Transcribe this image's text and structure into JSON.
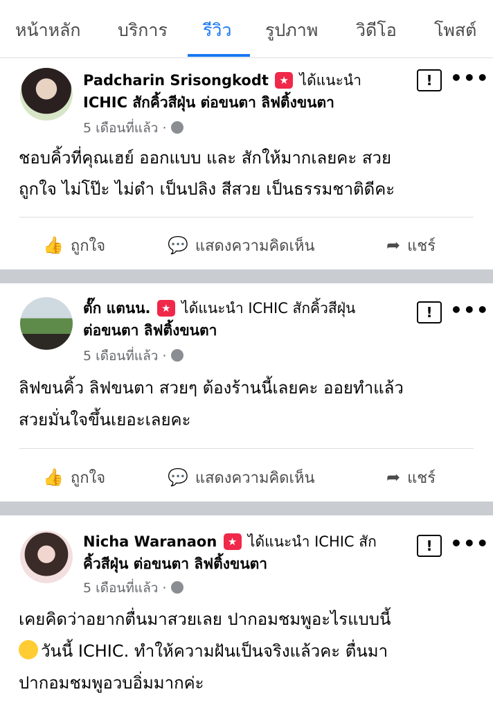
{
  "tabs": [
    "หน้าหลัก",
    "บริการ",
    "รีวิว",
    "รูปภาพ",
    "วิดีโอ",
    "โพสต์"
  ],
  "actions": {
    "like": "ถูกใจ",
    "comment": "แสดงความคิดเห็น",
    "share": "แชร์"
  },
  "badge_glyph": "★",
  "report_glyph": "!",
  "more_glyph": "•••",
  "icons": {
    "like": "thumbs-up-icon",
    "comment": "comment-bubble-icon",
    "share": "share-arrow-icon",
    "privacy": "globe-icon"
  },
  "posts": [
    {
      "line1": {
        "name": "Padcharin Srisongkodt",
        "rec": "ได้แนะนำ"
      },
      "line2": "ICHIC สักคิ้วสีฝุ่น ต่อขนตา ลิฟติ้งขนตา",
      "time": "5 เดือนที่แล้ว ·",
      "text": [
        "ชอบคิ้วที่คุณเฮย์  ออกแบบ และ สักให้มากเลยคะ สวย",
        "ถูกใจ ไม่โป๊ะ ไม่ดำ เป็นปลิง สีสวย เป็นธรรมชาติดีคะ"
      ]
    },
    {
      "line1": {
        "name": "ตั๊ก แตนน.",
        "rec": "ได้แนะนำ ICHIC สักคิ้วสีฝุ่น"
      },
      "line2": "ต่อขนตา ลิฟติ้งขนตา",
      "time": "5 เดือนที่แล้ว ·",
      "text": [
        "ลิฟขนคิ้ว ลิฟขนตา สวยๆ ต้องร้านนี้เลยคะ ออยทำแล้ว",
        "สวยมั่นใจขึ้นเยอะเลยคะ"
      ]
    },
    {
      "line1": {
        "name": "Nicha Waranaon",
        "rec": "ได้แนะนำ ICHIC สัก"
      },
      "line2": "คิ้วสีฝุ่น ต่อขนตา ลิฟติ้งขนตา",
      "time": "5 เดือนที่แล้ว ·",
      "text": [
        "เคยคิดว่าอยากตื่นมาสวยเลย  ปากอมชมพูอะไรแบบนี้",
        "วันนี้ ICHIC. ทำให้ความฝันเป็นจริงแล้วคะ ตื่นมา",
        "ปากอมชมพูอวบอิ่มมากค่ะ"
      ]
    }
  ]
}
